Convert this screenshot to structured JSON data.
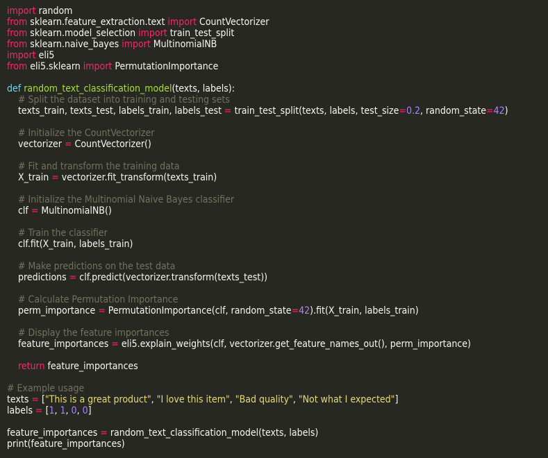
{
  "editor": {
    "colors": {
      "background": "#272822",
      "text": "#f8f8f2",
      "keyword": "#f92672",
      "function_name": "#a6e22e",
      "def_keyword": "#66d9ef",
      "number": "#ae81ff",
      "string": "#e6db74",
      "comment": "#75715e"
    },
    "lines": [
      [
        [
          "kw",
          "import"
        ],
        [
          "pl",
          " random"
        ]
      ],
      [
        [
          "kw",
          "from"
        ],
        [
          "pl",
          " sklearn.feature_extraction.text "
        ],
        [
          "kw",
          "import"
        ],
        [
          "pl",
          " CountVectorizer"
        ]
      ],
      [
        [
          "kw",
          "from"
        ],
        [
          "pl",
          " sklearn.model_selection "
        ],
        [
          "kw",
          "import"
        ],
        [
          "pl",
          " train_test_split"
        ]
      ],
      [
        [
          "kw",
          "from"
        ],
        [
          "pl",
          " sklearn.naive_bayes "
        ],
        [
          "kw",
          "import"
        ],
        [
          "pl",
          " MultinomialNB"
        ]
      ],
      [
        [
          "kw",
          "import"
        ],
        [
          "pl",
          " eli5"
        ]
      ],
      [
        [
          "kw",
          "from"
        ],
        [
          "pl",
          " eli5.sklearn "
        ],
        [
          "kw",
          "import"
        ],
        [
          "pl",
          " PermutationImportance"
        ]
      ],
      [],
      [
        [
          "dkw",
          "def"
        ],
        [
          "pl",
          " "
        ],
        [
          "fn",
          "random_text_classification_model"
        ],
        [
          "pl",
          "(texts, labels):"
        ]
      ],
      [
        [
          "cm",
          "    # Split the dataset into training and testing sets"
        ]
      ],
      [
        [
          "pl",
          "    texts_train, texts_test, labels_train, labels_test "
        ],
        [
          "op",
          "="
        ],
        [
          "pl",
          " train_test_split(texts, labels, test_size"
        ],
        [
          "op",
          "="
        ],
        [
          "num",
          "0.2"
        ],
        [
          "pl",
          ", random_state"
        ],
        [
          "op",
          "="
        ],
        [
          "num",
          "42"
        ],
        [
          "pl",
          ")"
        ]
      ],
      [],
      [
        [
          "cm",
          "    # Initialize the CountVectorizer"
        ]
      ],
      [
        [
          "pl",
          "    vectorizer "
        ],
        [
          "op",
          "="
        ],
        [
          "pl",
          " CountVectorizer()"
        ]
      ],
      [],
      [
        [
          "cm",
          "    # Fit and transform the training data"
        ]
      ],
      [
        [
          "pl",
          "    X_train "
        ],
        [
          "op",
          "="
        ],
        [
          "pl",
          " vectorizer.fit_transform(texts_train)"
        ]
      ],
      [],
      [
        [
          "cm",
          "    # Initialize the Multinomial Naive Bayes classifier"
        ]
      ],
      [
        [
          "pl",
          "    clf "
        ],
        [
          "op",
          "="
        ],
        [
          "pl",
          " MultinomialNB()"
        ]
      ],
      [],
      [
        [
          "cm",
          "    # Train the classifier"
        ]
      ],
      [
        [
          "pl",
          "    clf.fit(X_train, labels_train)"
        ]
      ],
      [],
      [
        [
          "cm",
          "    # Make predictions on the test data"
        ]
      ],
      [
        [
          "pl",
          "    predictions "
        ],
        [
          "op",
          "="
        ],
        [
          "pl",
          " clf.predict(vectorizer.transform(texts_test))"
        ]
      ],
      [],
      [
        [
          "cm",
          "    # Calculate Permutation Importance"
        ]
      ],
      [
        [
          "pl",
          "    perm_importance "
        ],
        [
          "op",
          "="
        ],
        [
          "pl",
          " PermutationImportance(clf, random_state"
        ],
        [
          "op",
          "="
        ],
        [
          "num",
          "42"
        ],
        [
          "pl",
          ").fit(X_train, labels_train)"
        ]
      ],
      [],
      [
        [
          "cm",
          "    # Display the feature importances"
        ]
      ],
      [
        [
          "pl",
          "    feature_importances "
        ],
        [
          "op",
          "="
        ],
        [
          "pl",
          " eli5.explain_weights(clf, vectorizer.get_feature_names_out(), perm_importance)"
        ]
      ],
      [],
      [
        [
          "pl",
          "    "
        ],
        [
          "kw",
          "return"
        ],
        [
          "pl",
          " feature_importances"
        ]
      ],
      [],
      [
        [
          "cm",
          "# Example usage"
        ]
      ],
      [
        [
          "pl",
          "texts "
        ],
        [
          "op",
          "="
        ],
        [
          "pl",
          " ["
        ],
        [
          "str",
          "\"This is a great product\""
        ],
        [
          "pl",
          ", "
        ],
        [
          "str",
          "\"I love this item\""
        ],
        [
          "pl",
          ", "
        ],
        [
          "str",
          "\"Bad quality\""
        ],
        [
          "pl",
          ", "
        ],
        [
          "str",
          "\"Not what I expected\""
        ],
        [
          "pl",
          "]"
        ]
      ],
      [
        [
          "pl",
          "labels "
        ],
        [
          "op",
          "="
        ],
        [
          "pl",
          " ["
        ],
        [
          "num",
          "1"
        ],
        [
          "pl",
          ", "
        ],
        [
          "num",
          "1"
        ],
        [
          "pl",
          ", "
        ],
        [
          "num",
          "0"
        ],
        [
          "pl",
          ", "
        ],
        [
          "num",
          "0"
        ],
        [
          "pl",
          "]"
        ]
      ],
      [],
      [
        [
          "pl",
          "feature_importances "
        ],
        [
          "op",
          "="
        ],
        [
          "pl",
          " random_text_classification_model(texts, labels)"
        ]
      ],
      [
        [
          "pl",
          "print(feature_importances)"
        ]
      ]
    ]
  }
}
